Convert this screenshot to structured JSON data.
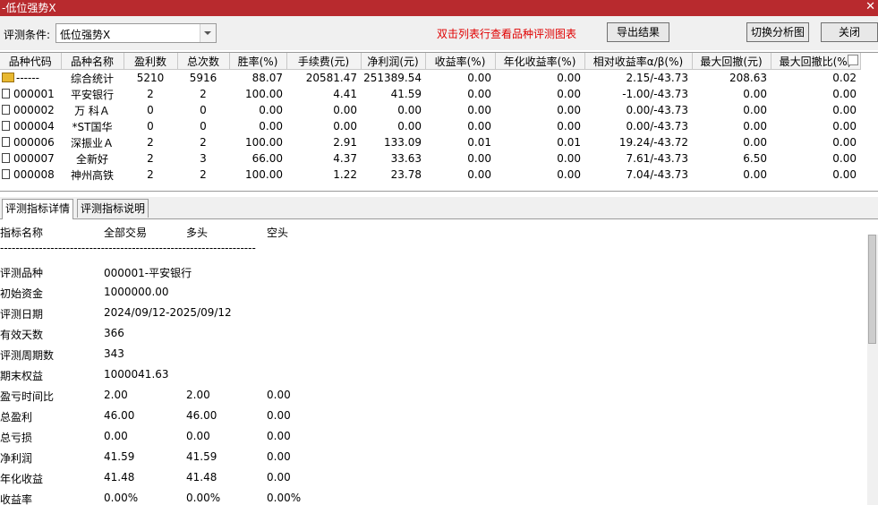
{
  "window": {
    "title": "-低位强势X",
    "close": "✕"
  },
  "toolbar": {
    "cond_label": "评测条件:",
    "cond_value": "低位强势X",
    "hint": "双击列表行查看品种评测图表",
    "export": "导出结果",
    "switch": "切换分析图",
    "close": "关闭"
  },
  "table": {
    "columns": [
      "品种代码",
      "品种名称",
      "盈利数",
      "总次数",
      "胜率(%)",
      "手续费(元)",
      "净利润(元)",
      "收益率(%)",
      "年化收益率(%)",
      "相对收益率α/β(%)",
      "最大回撤(元)",
      "最大回撤比(%)"
    ],
    "summary": [
      "------",
      "综合统计",
      "5210",
      "5916",
      "88.07",
      "20581.47",
      "251389.54",
      "0.00",
      "0.00",
      "2.15/-43.73",
      "208.63",
      "0.02"
    ],
    "rows": [
      [
        "000001",
        "平安银行",
        "2",
        "2",
        "100.00",
        "4.41",
        "41.59",
        "0.00",
        "0.00",
        "-1.00/-43.73",
        "0.00",
        "0.00"
      ],
      [
        "000002",
        "万 科Ａ",
        "0",
        "0",
        "0.00",
        "0.00",
        "0.00",
        "0.00",
        "0.00",
        "0.00/-43.73",
        "0.00",
        "0.00"
      ],
      [
        "000004",
        "*ST国华",
        "0",
        "0",
        "0.00",
        "0.00",
        "0.00",
        "0.00",
        "0.00",
        "0.00/-43.73",
        "0.00",
        "0.00"
      ],
      [
        "000006",
        "深振业Ａ",
        "2",
        "2",
        "100.00",
        "2.91",
        "133.09",
        "0.01",
        "0.01",
        "19.24/-43.72",
        "0.00",
        "0.00"
      ],
      [
        "000007",
        "全新好",
        "2",
        "3",
        "66.00",
        "4.37",
        "33.63",
        "0.00",
        "0.00",
        "7.61/-43.73",
        "6.50",
        "0.00"
      ],
      [
        "000008",
        "神州高铁",
        "2",
        "2",
        "100.00",
        "1.22",
        "23.78",
        "0.00",
        "0.00",
        "7.04/-43.73",
        "0.00",
        "0.00"
      ]
    ]
  },
  "tabs": [
    "评测指标详情",
    "评测指标说明"
  ],
  "detail": {
    "header": [
      "指标名称",
      "全部交易",
      "多头",
      "空头"
    ],
    "separator": "------------------------------------------------------------------",
    "lines": [
      {
        "label": "评测品种",
        "all": "000001-平安银行",
        "long": "",
        "short": ""
      },
      {
        "label": "初始资金",
        "all": "1000000.00",
        "long": "",
        "short": ""
      },
      {
        "label": "评测日期",
        "all": "2024/09/12-2025/09/12",
        "long": "",
        "short": ""
      },
      {
        "label": "有效天数",
        "all": "366",
        "long": "",
        "short": ""
      },
      {
        "label": "评测周期数",
        "all": "343",
        "long": "",
        "short": ""
      },
      {
        "label": "期末权益",
        "all": "1000041.63",
        "long": "",
        "short": ""
      },
      {
        "label": "盈亏时间比",
        "all": "2.00",
        "long": "2.00",
        "short": "0.00"
      },
      {
        "label": "总盈利",
        "all": "46.00",
        "long": "46.00",
        "short": "0.00"
      },
      {
        "label": "总亏损",
        "all": "0.00",
        "long": "0.00",
        "short": "0.00"
      },
      {
        "label": "净利润",
        "all": "41.59",
        "long": "41.59",
        "short": "0.00"
      },
      {
        "label": "年化收益",
        "all": "41.48",
        "long": "41.48",
        "short": "0.00"
      },
      {
        "label": "收益率",
        "all": "0.00%",
        "long": "0.00%",
        "short": "0.00%"
      }
    ]
  }
}
